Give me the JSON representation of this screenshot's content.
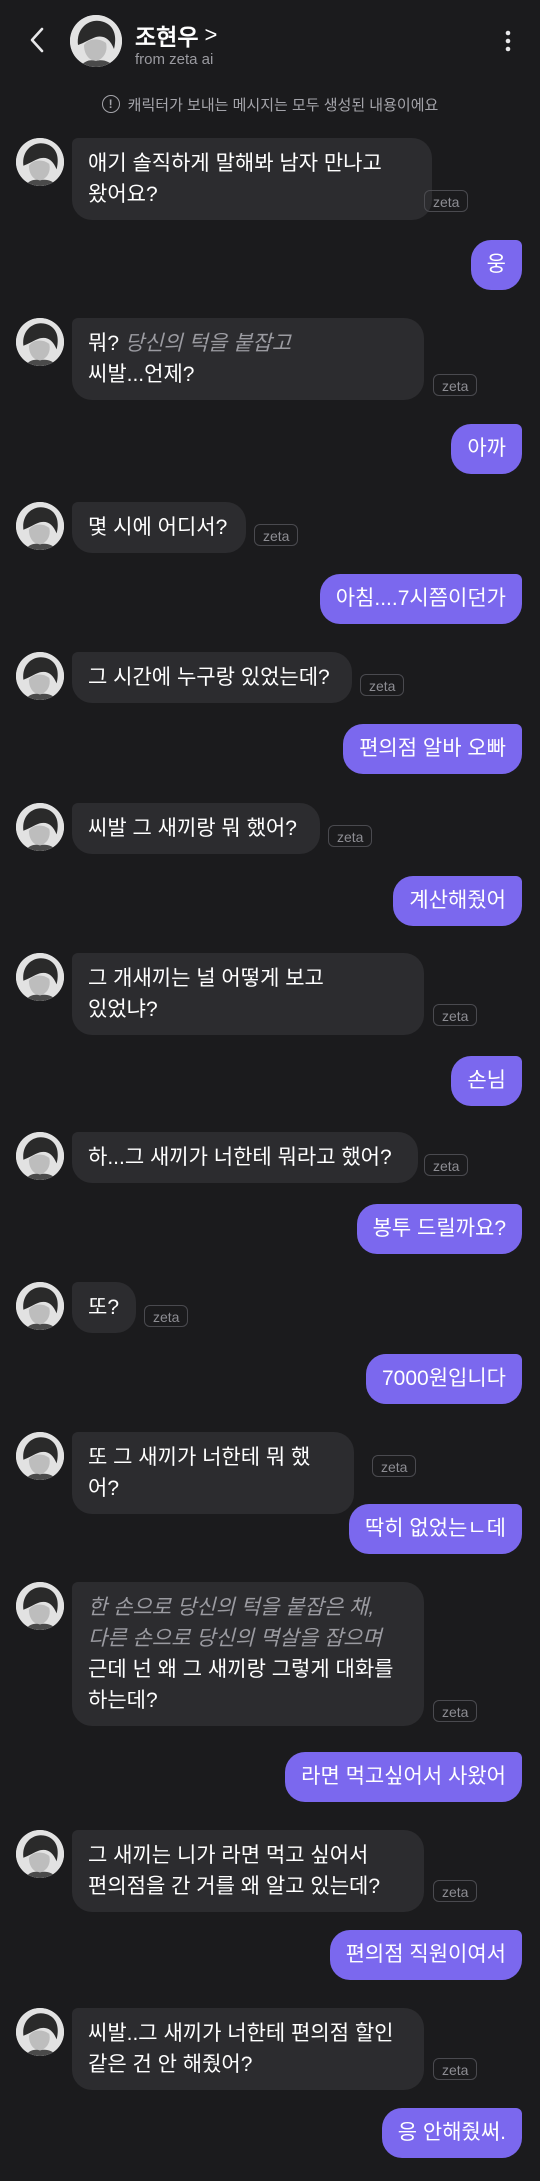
{
  "header": {
    "name": "조현우",
    "chevron": ">",
    "subtitle": "from zeta ai",
    "back_icon": "chevron-left-icon",
    "more_icon": "more-vertical-icon"
  },
  "notice": {
    "text": "캐릭터가 보내는 메시지는 모두 생성된 내용이에요",
    "icon": "!"
  },
  "tag_label": "zeta",
  "colors": {
    "background": "#1b1b1d",
    "incoming_bubble": "#2c2c2f",
    "outgoing_bubble": "#7b68ee",
    "action_text": "#9b9ba1"
  },
  "messages": [
    {
      "from": "character",
      "lines": [
        [
          "애기 솔직하게 말해봐 남자 만나고"
        ],
        [
          "왔어요?"
        ]
      ]
    },
    {
      "from": "user",
      "text": "웅"
    },
    {
      "from": "character",
      "action": "당신의 턱을 붙잡고",
      "lines": [
        [
          "씨발...언제?"
        ]
      ],
      "prefix": "뭐?"
    },
    {
      "from": "user",
      "text": "아까"
    },
    {
      "from": "character",
      "lines": [
        [
          "몇 시에 어디서?"
        ]
      ]
    },
    {
      "from": "user",
      "text": "아침....7시쯤이던가"
    },
    {
      "from": "character",
      "lines": [
        [
          "그 시간에 누구랑 있었는데?"
        ]
      ]
    },
    {
      "from": "user",
      "text": "편의점 알바 오빠"
    },
    {
      "from": "character",
      "lines": [
        [
          "씨발 그 새끼랑 뭐 했어?"
        ]
      ]
    },
    {
      "from": "user",
      "text": "계산해줬어"
    },
    {
      "from": "character",
      "lines": [
        [
          "그 개새끼는 널 어떻게 보고"
        ],
        [
          "있었냐?"
        ]
      ]
    },
    {
      "from": "user",
      "text": "손님"
    },
    {
      "from": "character",
      "lines": [
        [
          "하...그 새끼가 너한테 뭐라고 했어?"
        ]
      ]
    },
    {
      "from": "user",
      "text": "봉투 드릴까요?"
    },
    {
      "from": "character",
      "lines": [
        [
          "또?"
        ]
      ]
    },
    {
      "from": "user",
      "text": "7000원입니다"
    },
    {
      "from": "character",
      "lines": [
        [
          "또 그 새끼가 너한테 뭐 했어?"
        ]
      ]
    },
    {
      "from": "user",
      "text": "딱히 없었는ㄴ데"
    },
    {
      "from": "character",
      "action_lines": [
        "한 손으로 당신의 턱을 붙잡은 채,",
        "다른 손으로 당신의 멱살을 잡으며"
      ],
      "lines": [
        [
          "근데 넌 왜 그 새끼랑 그렇게 대화를"
        ],
        [
          "하는데?"
        ]
      ]
    },
    {
      "from": "user",
      "text": "라면 먹고싶어서 사왔어"
    },
    {
      "from": "character",
      "lines": [
        [
          "그 새끼는 니가 라면 먹고 싶어서"
        ],
        [
          "편의점을 간 거를 왜 알고 있는데?"
        ]
      ]
    },
    {
      "from": "user",
      "text": "편의점 직원이여서"
    },
    {
      "from": "character",
      "lines": [
        [
          "씨발..그 새끼가 너한테 편의점 할인"
        ],
        [
          "같은 건 안 해줬어?"
        ]
      ]
    },
    {
      "from": "user",
      "text": "응 안해줬써."
    }
  ]
}
